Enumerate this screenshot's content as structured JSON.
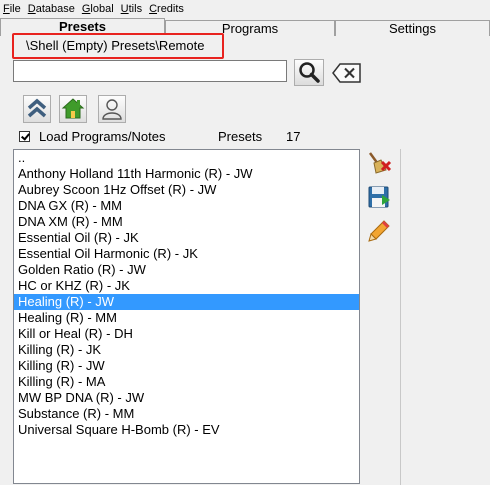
{
  "menubar": {
    "items": [
      "File",
      "Database",
      "Global",
      "Utils",
      "Credits"
    ]
  },
  "tabs": [
    {
      "label": "Presets",
      "active": true
    },
    {
      "label": "Programs",
      "active": false
    },
    {
      "label": "Settings",
      "active": false
    }
  ],
  "path": "\\Shell (Empty) Presets\\Remote",
  "search": {
    "value": "",
    "placeholder": ""
  },
  "icons": {
    "search": "magnifier-icon",
    "clear": "backspace-clear-icon",
    "up": "up-arrows-icon",
    "home": "home-icon",
    "user": "user-icon",
    "delete": "broom-delete-icon",
    "save": "save-disk-icon",
    "edit": "pencil-edit-icon"
  },
  "checkbox": {
    "label": "Load Programs/Notes",
    "checked": true
  },
  "presets": {
    "label": "Presets",
    "count": "17"
  },
  "list": {
    "items": [
      "..",
      "Anthony Holland 11th Harmonic (R) - JW",
      "Aubrey Scoon 1Hz Offset (R) - JW",
      "DNA GX (R) - MM",
      "DNA XM (R) - MM",
      "Essential Oil (R) - JK",
      "Essential Oil Harmonic (R) - JK",
      "Golden Ratio (R) - JW",
      "HC or KHZ (R) - JK",
      "Healing (R) - JW",
      "Healing (R) - MM",
      "Kill or Heal (R) - DH",
      "Killing (R) - JK",
      "Killing (R) - JW",
      "Killing (R) - MA",
      "MW BP DNA (R) - JW",
      "Substance (R) - MM",
      "Universal Square H-Bomb (R) - EV"
    ],
    "selected_index": 9
  },
  "colors": {
    "selection": "#3399ff",
    "highlight_border": "#e8231f"
  }
}
